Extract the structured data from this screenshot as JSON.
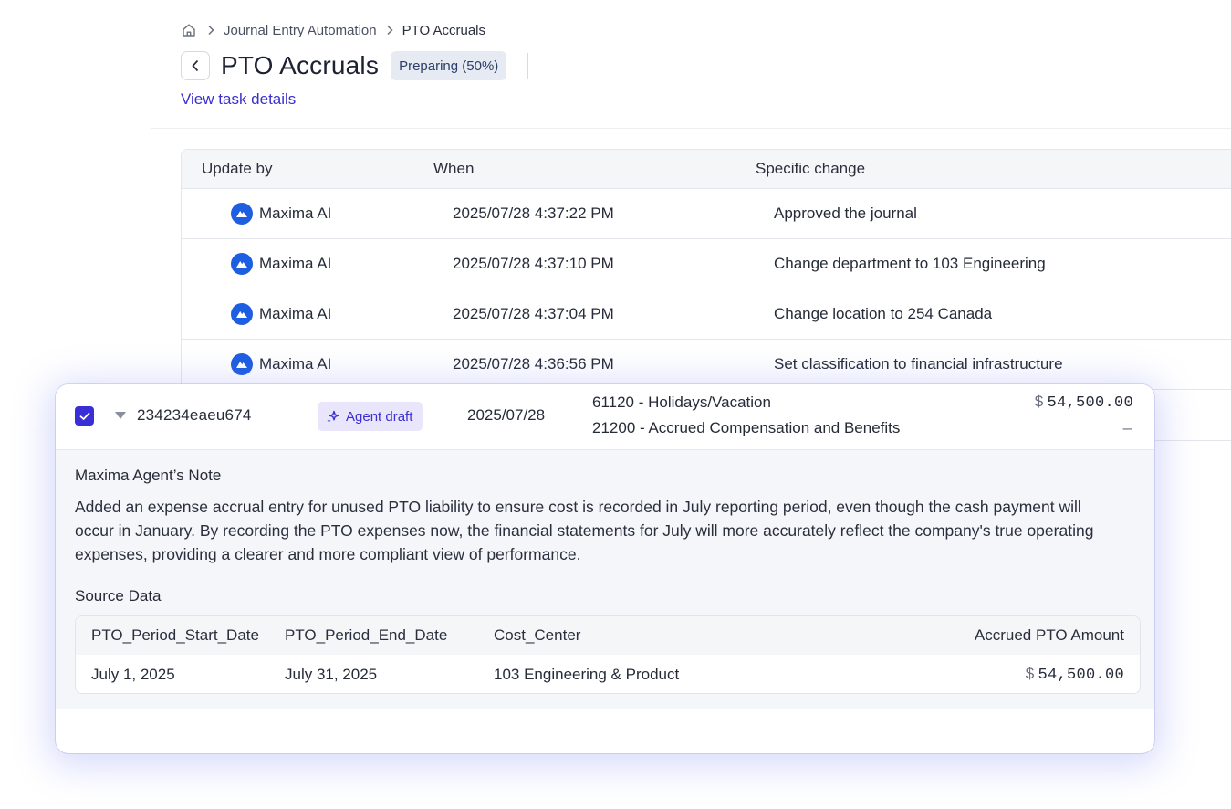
{
  "breadcrumb": {
    "home_icon": "home-icon",
    "items": [
      "Journal Entry Automation",
      "PTO Accruals"
    ]
  },
  "header": {
    "title": "PTO Accruals",
    "status": "Preparing (50%)",
    "view_details": "View task details"
  },
  "change_log": {
    "columns": [
      "Update by",
      "When",
      "Specific change"
    ],
    "rows": [
      {
        "user": "Maxima AI",
        "when": "2025/07/28 4:37:22 PM",
        "change": "Approved the journal"
      },
      {
        "user": "Maxima AI",
        "when": "2025/07/28 4:37:10 PM",
        "change": "Change department to 103 Engineering"
      },
      {
        "user": "Maxima AI",
        "when": "2025/07/28 4:37:04 PM",
        "change": "Change location to 254 Canada"
      },
      {
        "user": "Maxima AI",
        "when": "2025/07/28 4:36:56 PM",
        "change": "Set classification to financial infrastructure"
      }
    ]
  },
  "entry": {
    "id": "234234eaeu674",
    "badge": "Agent draft",
    "date": "2025/07/28",
    "account_debit": "61120 - Holidays/Vacation",
    "account_credit": "21200 - Accrued Compensation and Benefits",
    "currency_symbol": "$",
    "amount": "54,500.00",
    "credit_amount": "–",
    "checked": true
  },
  "note": {
    "title": "Maxima Agent’s Note",
    "text": "Added an expense accrual entry for unused PTO liability to ensure cost is recorded in July reporting period, even though the cash payment will occur in January. By recording the PTO expenses now, the financial statements for July will more accurately reflect the company's true operating expenses, providing a clearer and more compliant view of performance."
  },
  "source_data": {
    "title": "Source Data",
    "columns": [
      "PTO_Period_Start_Date",
      "PTO_Period_End_Date",
      "Cost_Center",
      "Accrued PTO Amount"
    ],
    "row": {
      "start": "July 1, 2025",
      "end": "July 31, 2025",
      "cost_center": "103 Engineering & Product",
      "currency_symbol": "$",
      "amount": "54,500.00"
    }
  },
  "colors": {
    "accent": "#3a2fd6",
    "link": "#3b2fd0",
    "maxima_blue": "#1e5ee0",
    "status_badge_bg": "#e6eaf3",
    "agent_badge_bg": "#e9e6fb"
  }
}
